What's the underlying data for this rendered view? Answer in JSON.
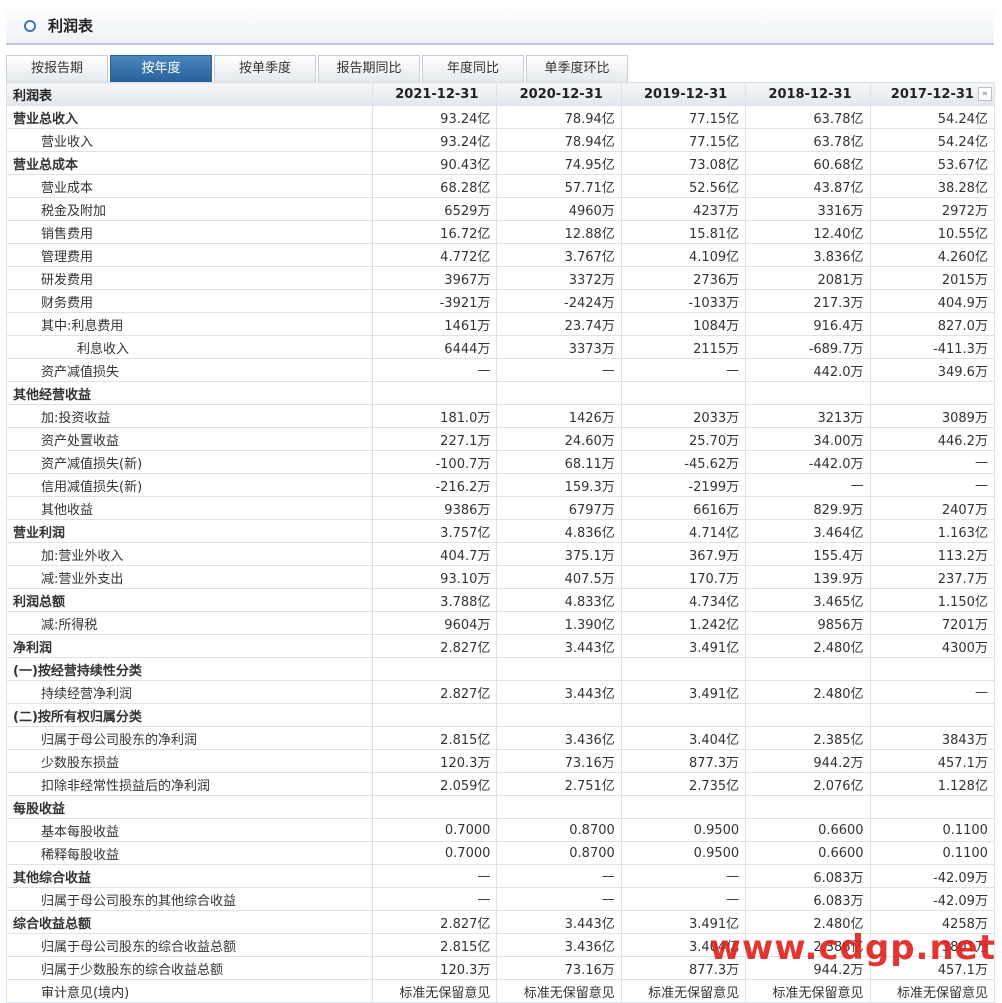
{
  "header": {
    "title": "利润表"
  },
  "tabs": [
    {
      "label": "按报告期",
      "active": false
    },
    {
      "label": "按年度",
      "active": true
    },
    {
      "label": "按单季度",
      "active": false
    },
    {
      "label": "报告期同比",
      "active": false
    },
    {
      "label": "年度同比",
      "active": false
    },
    {
      "label": "单季度环比",
      "active": false
    }
  ],
  "table": {
    "header": [
      "利润表",
      "2021-12-31",
      "2020-12-31",
      "2019-12-31",
      "2018-12-31",
      "2017-12-31"
    ],
    "rows": [
      {
        "level": 0,
        "label": "营业总收入",
        "values": [
          "93.24亿",
          "78.94亿",
          "77.15亿",
          "63.78亿",
          "54.24亿"
        ]
      },
      {
        "level": 1,
        "label": "营业收入",
        "values": [
          "93.24亿",
          "78.94亿",
          "77.15亿",
          "63.78亿",
          "54.24亿"
        ]
      },
      {
        "level": 0,
        "label": "营业总成本",
        "values": [
          "90.43亿",
          "74.95亿",
          "73.08亿",
          "60.68亿",
          "53.67亿"
        ]
      },
      {
        "level": 1,
        "label": "营业成本",
        "values": [
          "68.28亿",
          "57.71亿",
          "52.56亿",
          "43.87亿",
          "38.28亿"
        ]
      },
      {
        "level": 1,
        "label": "税金及附加",
        "values": [
          "6529万",
          "4960万",
          "4237万",
          "3316万",
          "2972万"
        ]
      },
      {
        "level": 1,
        "label": "销售费用",
        "values": [
          "16.72亿",
          "12.88亿",
          "15.81亿",
          "12.40亿",
          "10.55亿"
        ]
      },
      {
        "level": 1,
        "label": "管理费用",
        "values": [
          "4.772亿",
          "3.767亿",
          "4.109亿",
          "3.836亿",
          "4.260亿"
        ]
      },
      {
        "level": 1,
        "label": "研发费用",
        "values": [
          "3967万",
          "3372万",
          "2736万",
          "2081万",
          "2015万"
        ]
      },
      {
        "level": 1,
        "label": "财务费用",
        "values": [
          "-3921万",
          "-2424万",
          "-1033万",
          "217.3万",
          "404.9万"
        ]
      },
      {
        "level": 1,
        "label": "其中:利息费用",
        "values": [
          "1461万",
          "23.74万",
          "1084万",
          "916.4万",
          "827.0万"
        ]
      },
      {
        "level": 2,
        "label": "利息收入",
        "values": [
          "6444万",
          "3373万",
          "2115万",
          "-689.7万",
          "-411.3万"
        ]
      },
      {
        "level": 1,
        "label": "资产减值损失",
        "values": [
          "—",
          "—",
          "—",
          "442.0万",
          "349.6万"
        ]
      },
      {
        "level": 0,
        "label": "其他经营收益",
        "values": [
          "",
          "",
          "",
          "",
          ""
        ]
      },
      {
        "level": 1,
        "label": "加:投资收益",
        "values": [
          "181.0万",
          "1426万",
          "2033万",
          "3213万",
          "3089万"
        ]
      },
      {
        "level": 1,
        "label": "资产处置收益",
        "values": [
          "227.1万",
          "24.60万",
          "25.70万",
          "34.00万",
          "446.2万"
        ]
      },
      {
        "level": 1,
        "label": "资产减值损失(新)",
        "values": [
          "-100.7万",
          "68.11万",
          "-45.62万",
          "-442.0万",
          "—"
        ]
      },
      {
        "level": 1,
        "label": "信用减值损失(新)",
        "values": [
          "-216.2万",
          "159.3万",
          "-2199万",
          "—",
          "—"
        ]
      },
      {
        "level": 1,
        "label": "其他收益",
        "values": [
          "9386万",
          "6797万",
          "6616万",
          "829.9万",
          "2407万"
        ]
      },
      {
        "level": 0,
        "label": "营业利润",
        "values": [
          "3.757亿",
          "4.836亿",
          "4.714亿",
          "3.464亿",
          "1.163亿"
        ]
      },
      {
        "level": 1,
        "label": "加:营业外收入",
        "values": [
          "404.7万",
          "375.1万",
          "367.9万",
          "155.4万",
          "113.2万"
        ]
      },
      {
        "level": 1,
        "label": "减:营业外支出",
        "values": [
          "93.10万",
          "407.5万",
          "170.7万",
          "139.9万",
          "237.7万"
        ]
      },
      {
        "level": 0,
        "label": "利润总额",
        "values": [
          "3.788亿",
          "4.833亿",
          "4.734亿",
          "3.465亿",
          "1.150亿"
        ]
      },
      {
        "level": 1,
        "label": "减:所得税",
        "values": [
          "9604万",
          "1.390亿",
          "1.242亿",
          "9856万",
          "7201万"
        ]
      },
      {
        "level": 0,
        "label": "净利润",
        "values": [
          "2.827亿",
          "3.443亿",
          "3.491亿",
          "2.480亿",
          "4300万"
        ]
      },
      {
        "level": 0,
        "label": "(一)按经营持续性分类",
        "values": [
          "",
          "",
          "",
          "",
          ""
        ]
      },
      {
        "level": 1,
        "label": "持续经营净利润",
        "values": [
          "2.827亿",
          "3.443亿",
          "3.491亿",
          "2.480亿",
          "—"
        ]
      },
      {
        "level": 0,
        "label": "(二)按所有权归属分类",
        "values": [
          "",
          "",
          "",
          "",
          ""
        ]
      },
      {
        "level": 1,
        "label": "归属于母公司股东的净利润",
        "values": [
          "2.815亿",
          "3.436亿",
          "3.404亿",
          "2.385亿",
          "3843万"
        ]
      },
      {
        "level": 1,
        "label": "少数股东损益",
        "values": [
          "120.3万",
          "73.16万",
          "877.3万",
          "944.2万",
          "457.1万"
        ]
      },
      {
        "level": 1,
        "label": "扣除非经常性损益后的净利润",
        "values": [
          "2.059亿",
          "2.751亿",
          "2.735亿",
          "2.076亿",
          "1.128亿"
        ]
      },
      {
        "level": 0,
        "label": "每股收益",
        "values": [
          "",
          "",
          "",
          "",
          ""
        ]
      },
      {
        "level": 1,
        "label": "基本每股收益",
        "values": [
          "0.7000",
          "0.8700",
          "0.9500",
          "0.6600",
          "0.1100"
        ]
      },
      {
        "level": 1,
        "label": "稀释每股收益",
        "values": [
          "0.7000",
          "0.8700",
          "0.9500",
          "0.6600",
          "0.1100"
        ]
      },
      {
        "level": 0,
        "label": "其他综合收益",
        "values": [
          "—",
          "—",
          "—",
          "6.083万",
          "-42.09万"
        ]
      },
      {
        "level": 1,
        "label": "归属于母公司股东的其他综合收益",
        "values": [
          "—",
          "—",
          "—",
          "6.083万",
          "-42.09万"
        ]
      },
      {
        "level": 0,
        "label": "综合收益总额",
        "values": [
          "2.827亿",
          "3.443亿",
          "3.491亿",
          "2.480亿",
          "4258万"
        ]
      },
      {
        "level": 1,
        "label": "归属于母公司股东的综合收益总额",
        "values": [
          "2.815亿",
          "3.436亿",
          "3.404亿",
          "2.386亿",
          "3801万"
        ]
      },
      {
        "level": 1,
        "label": "归属于少数股东的综合收益总额",
        "values": [
          "120.3万",
          "73.16万",
          "877.3万",
          "944.2万",
          "457.1万"
        ]
      },
      {
        "level": 1,
        "label": "审计意见(境内)",
        "values": [
          "标准无保留意见",
          "标准无保留意见",
          "标准无保留意见",
          "标准无保留意见",
          "标准无保留意见"
        ]
      }
    ]
  },
  "more_icon": "»",
  "watermark": "www.cdgp.net",
  "colors": {
    "tab_active": "#2a619b",
    "watermark": "#e0201b"
  }
}
